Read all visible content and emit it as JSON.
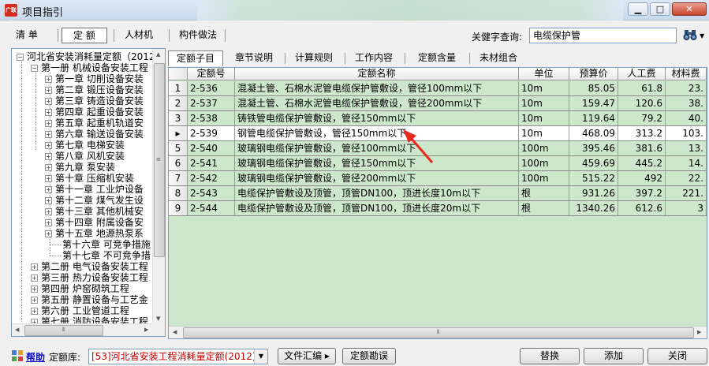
{
  "window": {
    "title": "项目指引",
    "icon_text": "广联达"
  },
  "top_tabs": [
    {
      "label": "清  单",
      "active": false
    },
    {
      "label": "定  额",
      "active": true
    },
    {
      "label": "人材机",
      "active": false
    },
    {
      "label": "构件做法",
      "active": false
    }
  ],
  "search": {
    "label": "关健字查询:",
    "value": "电缆保护管"
  },
  "tree": {
    "root": "河北省安装消耗量定额（2012",
    "book1": "第一册 机械设备安装工程",
    "chapters": [
      "第一章 切削设备安装",
      "第二章 锻压设备安装",
      "第三章 铸造设备安装",
      "第四章 起重设备安装",
      "第五章 起重机轨道安",
      "第六章 输送设备安装",
      "第七章 电梯安装",
      "第八章 风机安装",
      "第九章 泵安装",
      "第十章 压缩机安装",
      "第十一章 工业炉设备",
      "第十二章 煤气发生设",
      "第十三章 其他机械安",
      "第十四章 附属设备安",
      "第十五章 地源热泵系",
      "第十六章 可竞争措施",
      "第十七章 不可竞争措"
    ],
    "books": [
      "第二册 电气设备安装工程",
      "第三册 热力设备安装工程",
      "第四册 炉窑砌筑工程",
      "第五册 静置设备与工艺金",
      "第六册 工业管道工程",
      "第七册 消防设备安装工程"
    ]
  },
  "sub_tabs": [
    {
      "label": "定额子目",
      "active": true
    },
    {
      "label": "章节说明",
      "active": false
    },
    {
      "label": "计算规则",
      "active": false
    },
    {
      "label": "工作内容",
      "active": false
    },
    {
      "label": "定额含量",
      "active": false
    },
    {
      "label": "未材组合",
      "active": false
    }
  ],
  "table": {
    "columns": [
      "定额号",
      "定额名称",
      "单位",
      "预算价",
      "人工费",
      "材料费"
    ],
    "rows": [
      {
        "num": "1",
        "code": "2-536",
        "name": "混凝土管、石棉水泥管电缆保护管敷设，管径100mm以下",
        "unit": "10m",
        "price": "85.05",
        "labor": "61.8",
        "material": "23."
      },
      {
        "num": "2",
        "code": "2-537",
        "name": "混凝土管、石棉水泥管电缆保护管敷设，管径200mm以下",
        "unit": "10m",
        "price": "159.47",
        "labor": "120.6",
        "material": "38."
      },
      {
        "num": "3",
        "code": "2-538",
        "name": "铸铁管电缆保护管敷设，管径150mm以下",
        "unit": "10m",
        "price": "119.64",
        "labor": "79.2",
        "material": "40."
      },
      {
        "num": "▸",
        "code": "2-539",
        "name": "钢管电缆保护管敷设，管径150mm以下",
        "unit": "10m",
        "price": "468.09",
        "labor": "313.2",
        "material": "103."
      },
      {
        "num": "5",
        "code": "2-540",
        "name": "玻璃钢电缆保护管敷设，管径100mm以下",
        "unit": "100m",
        "price": "395.46",
        "labor": "381.6",
        "material": "13."
      },
      {
        "num": "6",
        "code": "2-541",
        "name": "玻璃钢电缆保护管敷设，管径150mm以下",
        "unit": "100m",
        "price": "459.69",
        "labor": "445.2",
        "material": "14."
      },
      {
        "num": "7",
        "code": "2-542",
        "name": "玻璃钢电缆保护管敷设，管径200mm以下",
        "unit": "100m",
        "price": "515.22",
        "labor": "492",
        "material": "22."
      },
      {
        "num": "8",
        "code": "2-543",
        "name": "电缆保护管敷设及顶管，顶管DN100，顶进长度10m以下",
        "unit": "根",
        "price": "931.26",
        "labor": "397.2",
        "material": "221."
      },
      {
        "num": "9",
        "code": "2-544",
        "name": "电缆保护管敷设及顶管，顶管DN100，顶进长度20m以下",
        "unit": "根",
        "price": "1340.26",
        "labor": "612.6",
        "material": "3"
      }
    ]
  },
  "bottom": {
    "help": "帮助",
    "lib_label": "定额库:",
    "lib_value": "[53]河北省安装工程消耗量定额(2012)",
    "buttons": {
      "file": "文件汇编 ▸",
      "errata": "定额勘误",
      "replace": "替换",
      "add": "添加",
      "close": "关闭"
    }
  },
  "colors": {
    "grid_bg": "#cde7cd",
    "selected_row": "#ffffff",
    "annotation": "#e8281e",
    "help_link": "#1111cc",
    "lib_text": "#c00000"
  }
}
